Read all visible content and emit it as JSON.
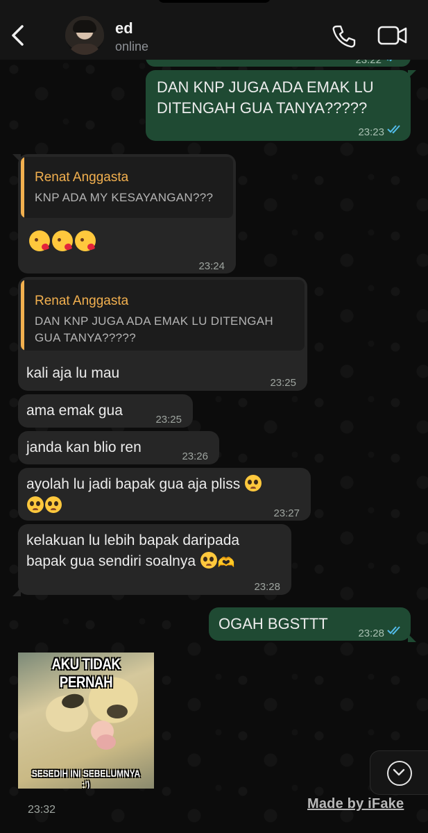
{
  "header": {
    "contact_name": "ed",
    "status": "online",
    "icons": [
      "chevron-left-icon",
      "avatar",
      "phone-icon",
      "video-camera-icon"
    ]
  },
  "partial_top": {
    "time": "23:22"
  },
  "messages": [
    {
      "direction": "out",
      "text_lines": [
        "DAN KNP JUGA ADA EMAK LU",
        "DITENGAH GUA TANYA?????"
      ],
      "time": "23:23",
      "status": "read"
    },
    {
      "direction": "in",
      "reply_to": {
        "name": "Renat Anggasta",
        "text": "KNP ADA MY KESAYANGAN???"
      },
      "emoji": "kissing-face-with-heart x3",
      "time": "23:24"
    },
    {
      "direction": "in",
      "reply_to": {
        "name": "Renat Anggasta",
        "text_lines": [
          "DAN KNP JUGA ADA EMAK LU DITENGAH",
          "GUA TANYA?????"
        ]
      },
      "text": "kali aja lu mau",
      "time": "23:25"
    },
    {
      "direction": "in",
      "text": "ama emak gua",
      "time": "23:25"
    },
    {
      "direction": "in",
      "text": "janda kan blio ren",
      "time": "23:26"
    },
    {
      "direction": "in",
      "text_lines": [
        "ayolah lu jadi bapak gua aja pliss"
      ],
      "time": "23:27",
      "emoji": "pleading-face x3"
    },
    {
      "direction": "in",
      "text_lines": [
        "kelakuan lu lebih bapak daripada",
        "bapak gua sendiri soalnya"
      ],
      "time": "23:28",
      "emoji": "pleading-face, heart-hands"
    },
    {
      "direction": "out",
      "text": "OGAH BGSTTT",
      "time": "23:28",
      "status": "read"
    },
    {
      "direction": "in",
      "type": "image",
      "meme_top": "AKU TIDAK PERNAH",
      "meme_bottom": "SESEDIH INI SEBELUMNYA :')",
      "time": "23:32"
    }
  ],
  "footer": {
    "watermark": "Made by iFake"
  },
  "colors": {
    "outgoing": "#1f4a33",
    "incoming": "#262626",
    "reply_name": "#f2b04f",
    "read_ticks": "#53bdeb"
  }
}
